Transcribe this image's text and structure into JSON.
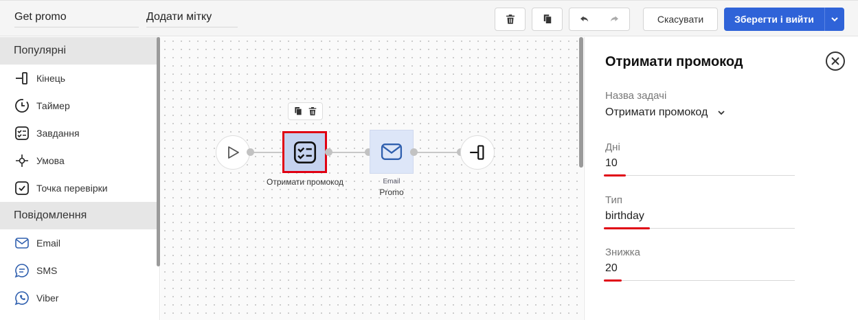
{
  "toolbar": {
    "name_value": "Get promo",
    "tag_value": "Додати мітку",
    "cancel_label": "Скасувати",
    "save_label": "Зберегти і вийти"
  },
  "sidebar": {
    "sections": [
      {
        "title": "Популярні",
        "items": [
          {
            "label": "Кінець",
            "icon": "end-icon"
          },
          {
            "label": "Таймер",
            "icon": "timer-icon"
          },
          {
            "label": "Завдання",
            "icon": "task-icon"
          },
          {
            "label": "Умова",
            "icon": "condition-icon"
          },
          {
            "label": "Точка перевірки",
            "icon": "checkpoint-icon"
          }
        ]
      },
      {
        "title": "Повідомлення",
        "items": [
          {
            "label": "Email",
            "icon": "email-icon"
          },
          {
            "label": "SMS",
            "icon": "sms-icon"
          },
          {
            "label": "Viber",
            "icon": "viber-icon"
          }
        ]
      }
    ]
  },
  "canvas": {
    "task_node_label": "Отримати промокод",
    "email_node_type": "Email",
    "email_node_label": "Promo"
  },
  "panel": {
    "title": "Отримати промокод",
    "task_name_label": "Назва задачі",
    "task_name_value": "Отримати промокод",
    "days_label": "Дні",
    "days_value": "10",
    "type_label": "Тип",
    "type_value": "birthday",
    "discount_label": "Знижка",
    "discount_value": "20"
  },
  "colors": {
    "accent": "#2f63d8",
    "selection": "#e00012",
    "task_node_bg": "#c5d2ef",
    "email_node_bg": "#dde6f8",
    "section_bg": "#e6e6e6"
  }
}
